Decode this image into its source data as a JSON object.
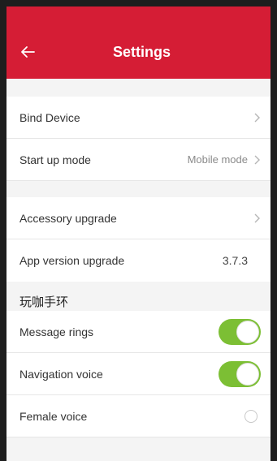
{
  "header": {
    "title": "Settings",
    "back_icon": "arrow-left-icon"
  },
  "group1": {
    "bind_device": {
      "label": "Bind Device"
    },
    "startup_mode": {
      "label": "Start up mode",
      "value": "Mobile mode"
    }
  },
  "group2": {
    "accessory_upgrade": {
      "label": "Accessory upgrade"
    },
    "app_version": {
      "label": "App version upgrade",
      "value": "3.7.3"
    }
  },
  "section": {
    "title": "玩咖手环"
  },
  "group3": {
    "message_rings": {
      "label": "Message rings",
      "on": true
    },
    "navigation_voice": {
      "label": "Navigation voice",
      "on": true
    },
    "female_voice": {
      "label": "Female voice",
      "selected": false
    }
  },
  "colors": {
    "brand": "#d51d35",
    "toggle_on": "#7cbf34"
  }
}
